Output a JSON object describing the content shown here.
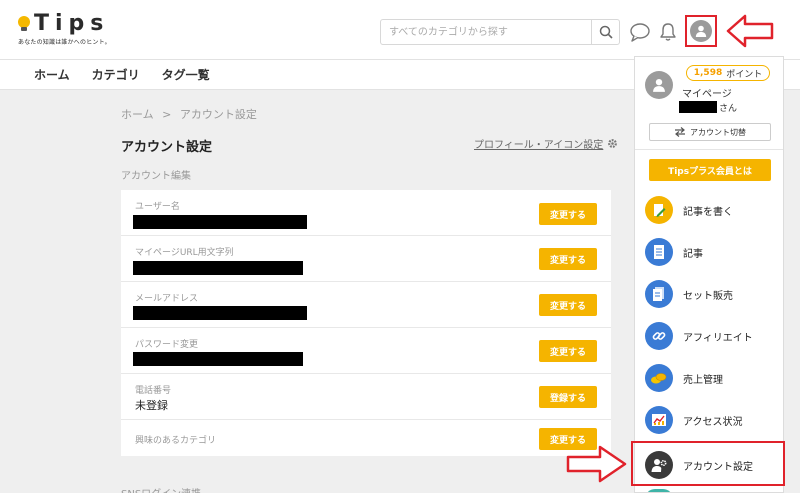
{
  "header": {
    "logo_text": "Tips",
    "logo_tagline": "あなたの知識は誰かへのヒント。",
    "search_placeholder": "すべてのカテゴリから探す"
  },
  "nav": {
    "items": [
      "ホーム",
      "カテゴリ",
      "タグ一覧"
    ]
  },
  "breadcrumb": {
    "home": "ホーム",
    "sep": ">",
    "current": "アカウント設定"
  },
  "page": {
    "title": "アカウント設定",
    "profile_link": "プロフィール・アイコン設定",
    "section_label": "アカウント編集",
    "sns_label": "SNSログイン連携"
  },
  "rows": [
    {
      "label": "ユーザー名",
      "button": "変更する"
    },
    {
      "label": "マイページURL用文字列",
      "button": "変更する"
    },
    {
      "label": "メールアドレス",
      "button": "変更する"
    },
    {
      "label": "パスワード変更",
      "button": "変更する"
    },
    {
      "label": "電話番号",
      "value": "未登録",
      "button": "登録する"
    },
    {
      "label": "興味のあるカテゴリ",
      "button": "変更する"
    }
  ],
  "dropdown": {
    "points_value": "1,598",
    "points_unit": "ポイント",
    "mypage": "マイページ",
    "san": "さん",
    "switch_label": "アカウント切替",
    "plus_label": "Tipsプラス会員とは",
    "menu": [
      {
        "label": "記事を書く",
        "icon": "pencil-icon",
        "color": "#f5b400"
      },
      {
        "label": "記事",
        "icon": "document-icon",
        "color": "#3a7bd5"
      },
      {
        "label": "セット販売",
        "icon": "docs-icon",
        "color": "#3a7bd5"
      },
      {
        "label": "アフィリエイト",
        "icon": "link-icon",
        "color": "#3a7bd5"
      },
      {
        "label": "売上管理",
        "icon": "coins-icon",
        "color": "#3a7bd5"
      },
      {
        "label": "アクセス状況",
        "icon": "chart-icon",
        "color": "#3a7bd5"
      },
      {
        "label": "アカウント設定",
        "icon": "user-gear-icon",
        "color": "#3a3a3a"
      }
    ]
  },
  "colors": {
    "accent": "#f5b400",
    "highlight": "#e0222b"
  }
}
